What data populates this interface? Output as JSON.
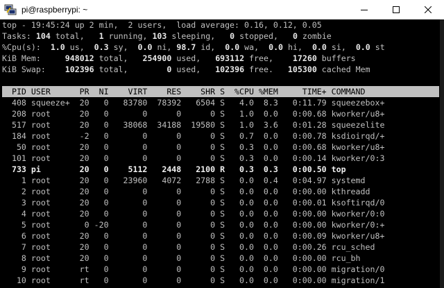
{
  "window": {
    "title": "pi@raspberrypi: ~"
  },
  "summary": {
    "uptime_line": "top - 19:45:24 up 2 min,  2 users,  load average: 0.16, 0.12, 0.05",
    "tasks": {
      "label": "Tasks:",
      "total": "104",
      "total_label": "total,",
      "running": "1",
      "running_label": "running,",
      "sleeping": "103",
      "sleeping_label": "sleeping,",
      "stopped": "0",
      "stopped_label": "stopped,",
      "zombie": "0",
      "zombie_label": "zombie"
    },
    "cpu": {
      "label": "%Cpu(s):",
      "us": "1.0",
      "us_label": "us,",
      "sy": "0.3",
      "sy_label": "sy,",
      "ni": "0.0",
      "ni_label": "ni,",
      "id": "98.7",
      "id_label": "id,",
      "wa": "0.0",
      "wa_label": "wa,",
      "hi": "0.0",
      "hi_label": "hi,",
      "si": "0.0",
      "si_label": "si,",
      "st": "0.0",
      "st_label": "st"
    },
    "mem": {
      "label": "KiB Mem:",
      "total": "948012",
      "total_label": "total,",
      "used": "254900",
      "used_label": "used,",
      "free": "693112",
      "free_label": "free,",
      "buffers": "17260",
      "buffers_label": "buffers"
    },
    "swap": {
      "label": "KiB Swap:",
      "total": "102396",
      "total_label": "total,",
      "used": "0",
      "used_label": "used,",
      "free": "102396",
      "free_label": "free.",
      "cached": "105300",
      "cached_label": "cached Mem"
    }
  },
  "table": {
    "header": "  PID USER      PR  NI    VIRT    RES    SHR S  %CPU %MEM     TIME+ COMMAND",
    "rows": [
      "  408 squeeze+  20   0   83780  78392   6504 S   4.0  8.3   0:11.79 squeezebox+",
      "  208 root      20   0       0      0      0 S   1.0  0.0   0:00.68 kworker/u8+",
      "  517 root      20   0   38068  34188  19580 S   1.0  3.6   0:01.28 squeezelite",
      "  184 root      -2   0       0      0      0 S   0.7  0.0   0:00.78 ksdioirqd/+",
      "   50 root      20   0       0      0      0 S   0.3  0.0   0:00.68 kworker/u8+",
      "  101 root      20   0       0      0      0 S   0.3  0.0   0:00.14 kworker/0:3",
      "  733 pi        20   0    5112   2448   2100 R   0.3  0.3   0:00.50 top",
      "    1 root      20   0   23960   4072   2788 S   0.0  0.4   0:04.97 systemd",
      "    2 root      20   0       0      0      0 S   0.0  0.0   0:00.00 kthreadd",
      "    3 root      20   0       0      0      0 S   0.0  0.0   0:00.01 ksoftirqd/0",
      "    4 root      20   0       0      0      0 S   0.0  0.0   0:00.00 kworker/0:0",
      "    5 root       0 -20       0      0      0 S   0.0  0.0   0:00.00 kworker/0:+",
      "    6 root      20   0       0      0      0 S   0.0  0.0   0:00.09 kworker/u8+",
      "    7 root      20   0       0      0      0 S   0.0  0.0   0:00.26 rcu_sched",
      "    8 root      20   0       0      0      0 S   0.0  0.0   0:00.00 rcu_bh",
      "    9 root      rt   0       0      0      0 S   0.0  0.0   0:00.00 migration/0",
      "   10 root      rt   0       0      0      0 S   0.0  0.0   0:00.00 migration/1"
    ],
    "highlight_row": 6
  },
  "colors": {
    "terminal_bg": "#000000",
    "terminal_fg": "#c0c0c0",
    "header_bg": "#c0c0c0",
    "titlebar_bg": "#ffffff"
  },
  "icons": {
    "app": "putty-icon",
    "minimize": "minimize-icon",
    "maximize": "maximize-icon",
    "close": "close-icon"
  }
}
